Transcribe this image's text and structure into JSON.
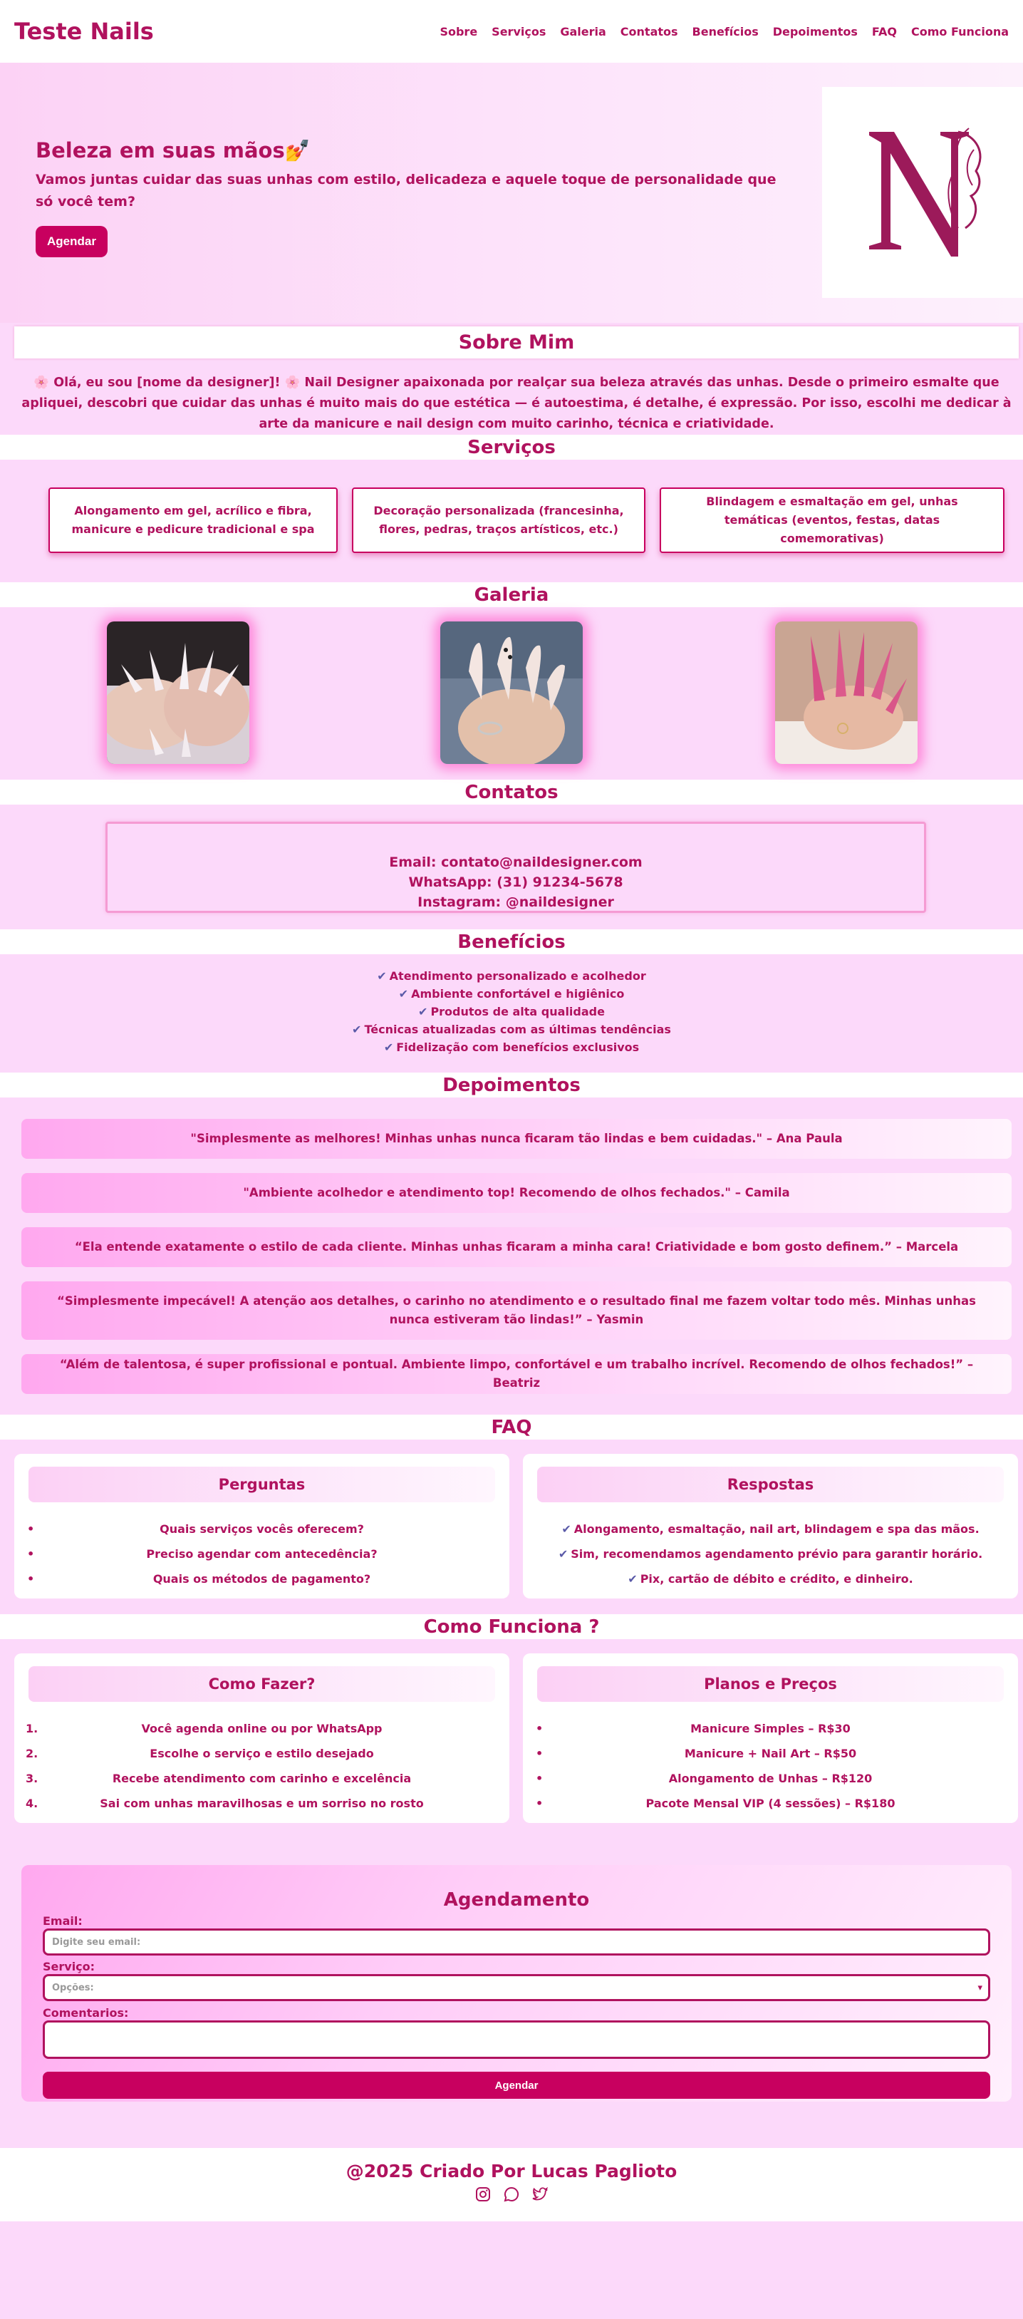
{
  "header": {
    "logo": "Teste Nails",
    "nav": [
      "Sobre",
      "Serviços",
      "Galeria",
      "Contatos",
      "Benefícios",
      "Depoimentos",
      "FAQ",
      "Como Funciona"
    ]
  },
  "hero": {
    "title": "Beleza em suas mãos💅",
    "subtitle": "Vamos juntas cuidar das suas unhas com estilo, delicadeza e aquele toque de personalidade que só você tem?",
    "button": "Agendar"
  },
  "sobre": {
    "title": "Sobre Mim",
    "text": "🌸 Olá, eu sou [nome da designer]! 🌸 Nail Designer apaixonada por realçar sua beleza através das unhas. Desde o primeiro esmalte que apliquei, descobri que cuidar das unhas é muito mais do que estética — é autoestima, é detalhe, é expressão. Por isso, escolhi me dedicar à arte da manicure e nail design com muito carinho, técnica e criatividade."
  },
  "servicos": {
    "title": "Serviços",
    "items": [
      "Alongamento em gel, acrílico e fibra, manicure e pedicure tradicional e spa",
      "Decoração personalizada (francesinha, flores, pedras, traços artísticos, etc.)",
      "Blindagem e esmaltação em gel, unhas temáticas (eventos, festas, datas comemorativas)"
    ]
  },
  "galeria": {
    "title": "Galeria"
  },
  "contatos": {
    "title": "Contatos",
    "email": "Email: contato@naildesigner.com",
    "whatsapp": "WhatsApp: (31) 91234-5678",
    "instagram": "Instagram: @naildesigner"
  },
  "beneficios": {
    "title": "Benefícios",
    "items": [
      "Atendimento personalizado e acolhedor",
      "Ambiente confortável e higiênico",
      "Produtos de alta qualidade",
      "Técnicas atualizadas com as últimas tendências",
      "Fidelização com benefícios exclusivos"
    ]
  },
  "depoimentos": {
    "title": "Depoimentos",
    "items": [
      "\"Simplesmente as melhores! Minhas unhas nunca ficaram tão lindas e bem cuidadas.\" – Ana Paula",
      "\"Ambiente acolhedor e atendimento top! Recomendo de olhos fechados.\" – Camila",
      "“Ela entende exatamente o estilo de cada cliente. Minhas unhas ficaram a minha cara! Criatividade e bom gosto definem.” – Marcela",
      "“Simplesmente impecável! A atenção aos detalhes, o carinho no atendimento e o resultado final me fazem voltar todo mês. Minhas unhas nunca estiveram tão lindas!” – Yasmin",
      "“Além de talentosa, é super profissional e pontual. Ambiente limpo, confortável e um trabalho incrível. Recomendo de olhos fechados!” – Beatriz"
    ]
  },
  "faq": {
    "title": "FAQ",
    "perguntas_title": "Perguntas",
    "perguntas": [
      "Quais serviços vocês oferecem?",
      "Preciso agendar com antecedência?",
      "Quais os métodos de pagamento?"
    ],
    "respostas_title": "Respostas",
    "respostas": [
      "Alongamento, esmaltação, nail art, blindagem e spa das mãos.",
      "Sim, recomendamos agendamento prévio para garantir horário.",
      "Pix, cartão de débito e crédito, e dinheiro."
    ]
  },
  "como_funciona": {
    "title": "Como Funciona ?",
    "fazer_title": "Como Fazer?",
    "passos": [
      "Você agenda online ou por WhatsApp",
      "Escolhe o serviço e estilo desejado",
      "Recebe atendimento com carinho e excelência",
      "Sai com unhas maravilhosas e um sorriso no rosto"
    ],
    "planos_title": "Planos e Preços",
    "planos": [
      "Manicure Simples – R$30",
      "Manicure + Nail Art – R$50",
      "Alongamento de Unhas – R$120",
      "Pacote Mensal VIP (4 sessões) – R$180"
    ]
  },
  "agendamento": {
    "title": "Agendamento",
    "email_label": "Email:",
    "email_placeholder": "Digite seu email:",
    "servico_label": "Serviço:",
    "servico_selected": "Opções:",
    "comentarios_label": "Comentarios:",
    "button": "Agendar"
  },
  "footer": {
    "text": "@2025 Criado Por Lucas Paglioto",
    "icons": [
      "instagram-icon",
      "whatsapp-icon",
      "twitter-icon"
    ]
  },
  "colors": {
    "primary": "#b0125e",
    "button": "#c8005f",
    "background": "#fcd9fa",
    "check": "#5a5aa8"
  }
}
